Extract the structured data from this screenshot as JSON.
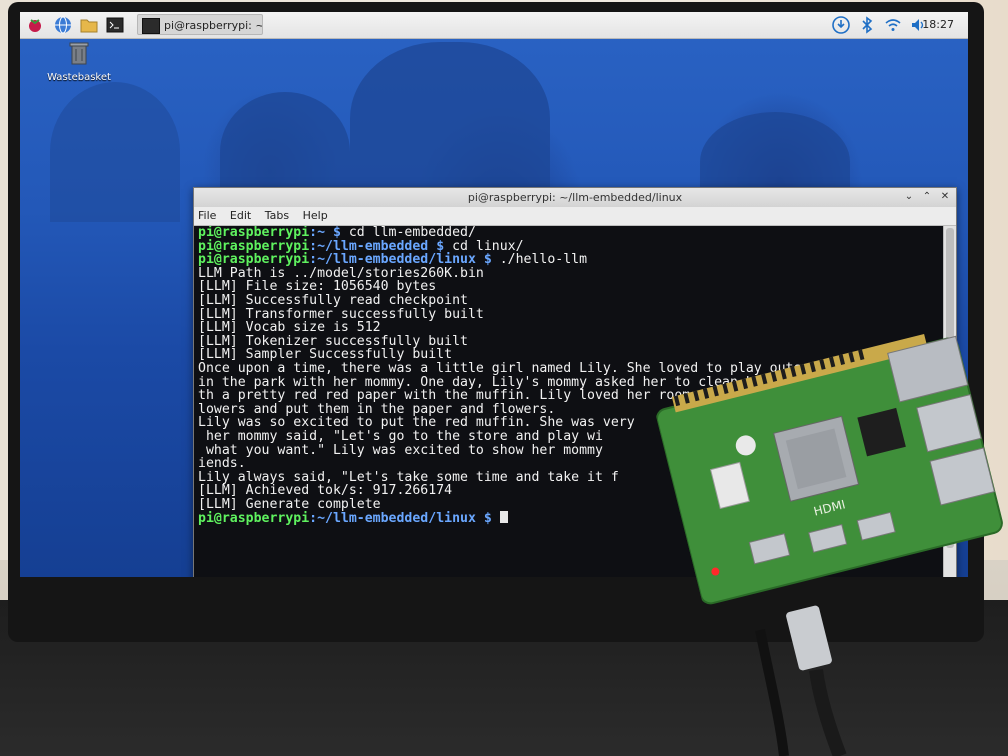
{
  "taskbar": {
    "task_title": "pi@raspberrypi: ~/ll...",
    "clock": "18:27"
  },
  "desktop": {
    "icons": [
      {
        "label": "Wastebasket",
        "icon": "trash-icon"
      }
    ]
  },
  "terminal": {
    "title": "pi@raspberrypi: ~/llm-embedded/linux",
    "menu": [
      "File",
      "Edit",
      "Tabs",
      "Help"
    ],
    "lines": [
      {
        "user": "pi@raspberrypi",
        "path": ":~ $ ",
        "cmd": "cd llm-embedded/"
      },
      {
        "user": "pi@raspberrypi",
        "path": ":~/llm-embedded $ ",
        "cmd": "cd linux/"
      },
      {
        "user": "pi@raspberrypi",
        "path": ":~/llm-embedded/linux $ ",
        "cmd": "./hello-llm"
      },
      {
        "text": "LLM Path is ../model/stories260K.bin"
      },
      {
        "text": "[LLM] File size: 1056540 bytes"
      },
      {
        "text": "[LLM] Successfully read checkpoint"
      },
      {
        "text": "[LLM] Transformer successfully built"
      },
      {
        "text": "[LLM] Vocab size is 512"
      },
      {
        "text": "[LLM] Tokenizer successfully built"
      },
      {
        "text": "[LLM] Sampler Successfully built"
      },
      {
        "text": "Once upon a time, there was a little girl named Lily. She loved to play outs"
      },
      {
        "text": "in the park with her mommy. One day, Lily's mommy asked her to clean her"
      },
      {
        "text": "th a pretty red red paper with the muffin. Lily loved her room and"
      },
      {
        "text": "lowers and put them in the paper and flowers."
      },
      {
        "text": "Lily was so excited to put the red muffin. She was very"
      },
      {
        "text": " her mommy said, \"Let's go to the store and play wi"
      },
      {
        "text": " what you want.\" Lily was excited to show her mommy"
      },
      {
        "text": "iends."
      },
      {
        "text": "Lily always said, \"Let's take some time and take it f"
      },
      {
        "text": "[LLM] Achieved tok/s: 917.266174"
      },
      {
        "text": "[LLM] Generate complete"
      },
      {
        "user": "pi@raspberrypi",
        "path": ":~/llm-embedded/linux $ ",
        "cmd": "",
        "cursor": true
      }
    ]
  },
  "board": {
    "label": "HDMI"
  },
  "colors": {
    "prompt_user": "#5ff25f",
    "prompt_path": "#6aa7ff",
    "terminal_bg": "#0e0f13",
    "desktop_blue": "#2358b8",
    "board_green": "#3f8f3a"
  }
}
